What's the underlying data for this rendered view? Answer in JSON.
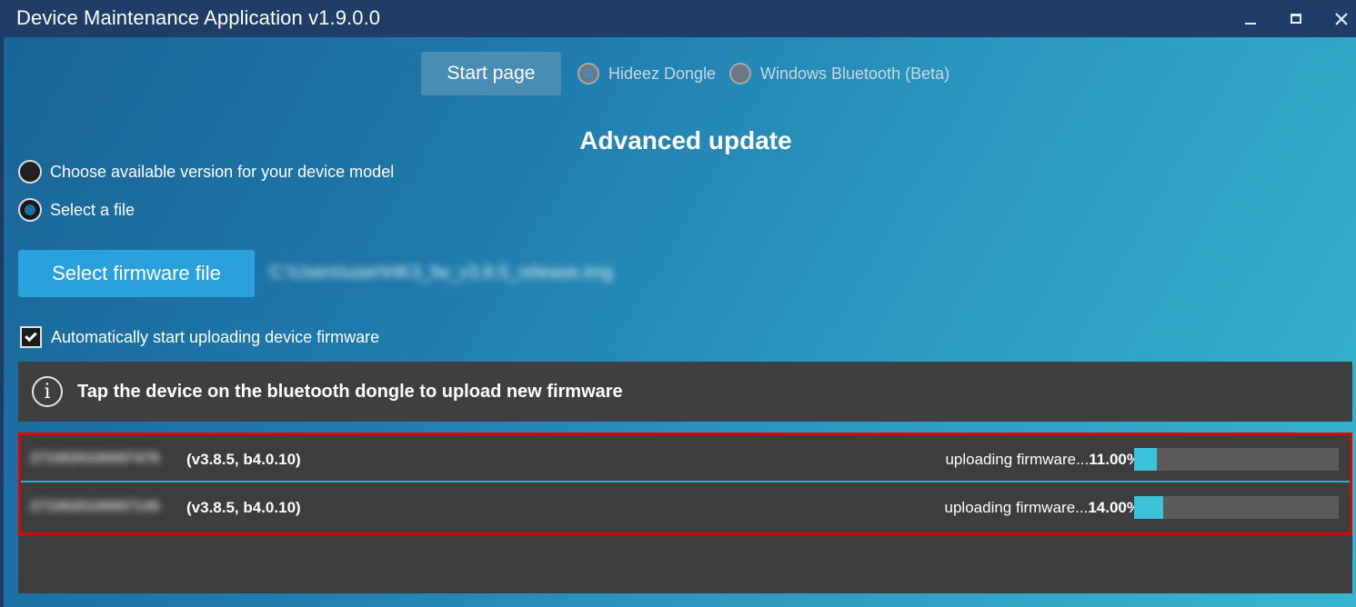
{
  "window": {
    "title": "Device Maintenance Application v1.9.0.0",
    "controls": {
      "minimize": "minimize-icon",
      "maximize": "maximize-icon",
      "close": "close-icon"
    }
  },
  "nav": {
    "start_page": "Start page",
    "connections": [
      {
        "label": "Hideez Dongle",
        "selected": true
      },
      {
        "label": "Windows Bluetooth (Beta)",
        "selected": false
      }
    ]
  },
  "heading": "Advanced update",
  "options": [
    {
      "label": "Choose available version for your device model",
      "selected": false
    },
    {
      "label": "Select a file",
      "selected": true
    }
  ],
  "select_firmware_button": "Select firmware file",
  "firmware_path": "C:\\Users\\user\\HK3_fw_v3.8.5_release.img",
  "auto_upload": {
    "label": "Automatically start uploading device firmware",
    "checked": true
  },
  "info": {
    "icon": "info-icon",
    "text": "Tap the device on the bluetooth dongle to upload new firmware"
  },
  "devices": [
    {
      "serial": "2710020100007476",
      "version": "(v3.8.5, b4.0.10)",
      "status": "uploading firmware...",
      "progress_text": "11.00%",
      "progress": 0.11
    },
    {
      "serial": "2710020100007145",
      "version": "(v3.8.5, b4.0.10)",
      "status": "uploading firmware...",
      "progress_text": "14.00%",
      "progress": 0.14
    }
  ],
  "colors": {
    "accent": "#2aa0dc",
    "progress": "#3cc3da",
    "highlight": "#e00000",
    "panel": "#3d3d3d"
  }
}
